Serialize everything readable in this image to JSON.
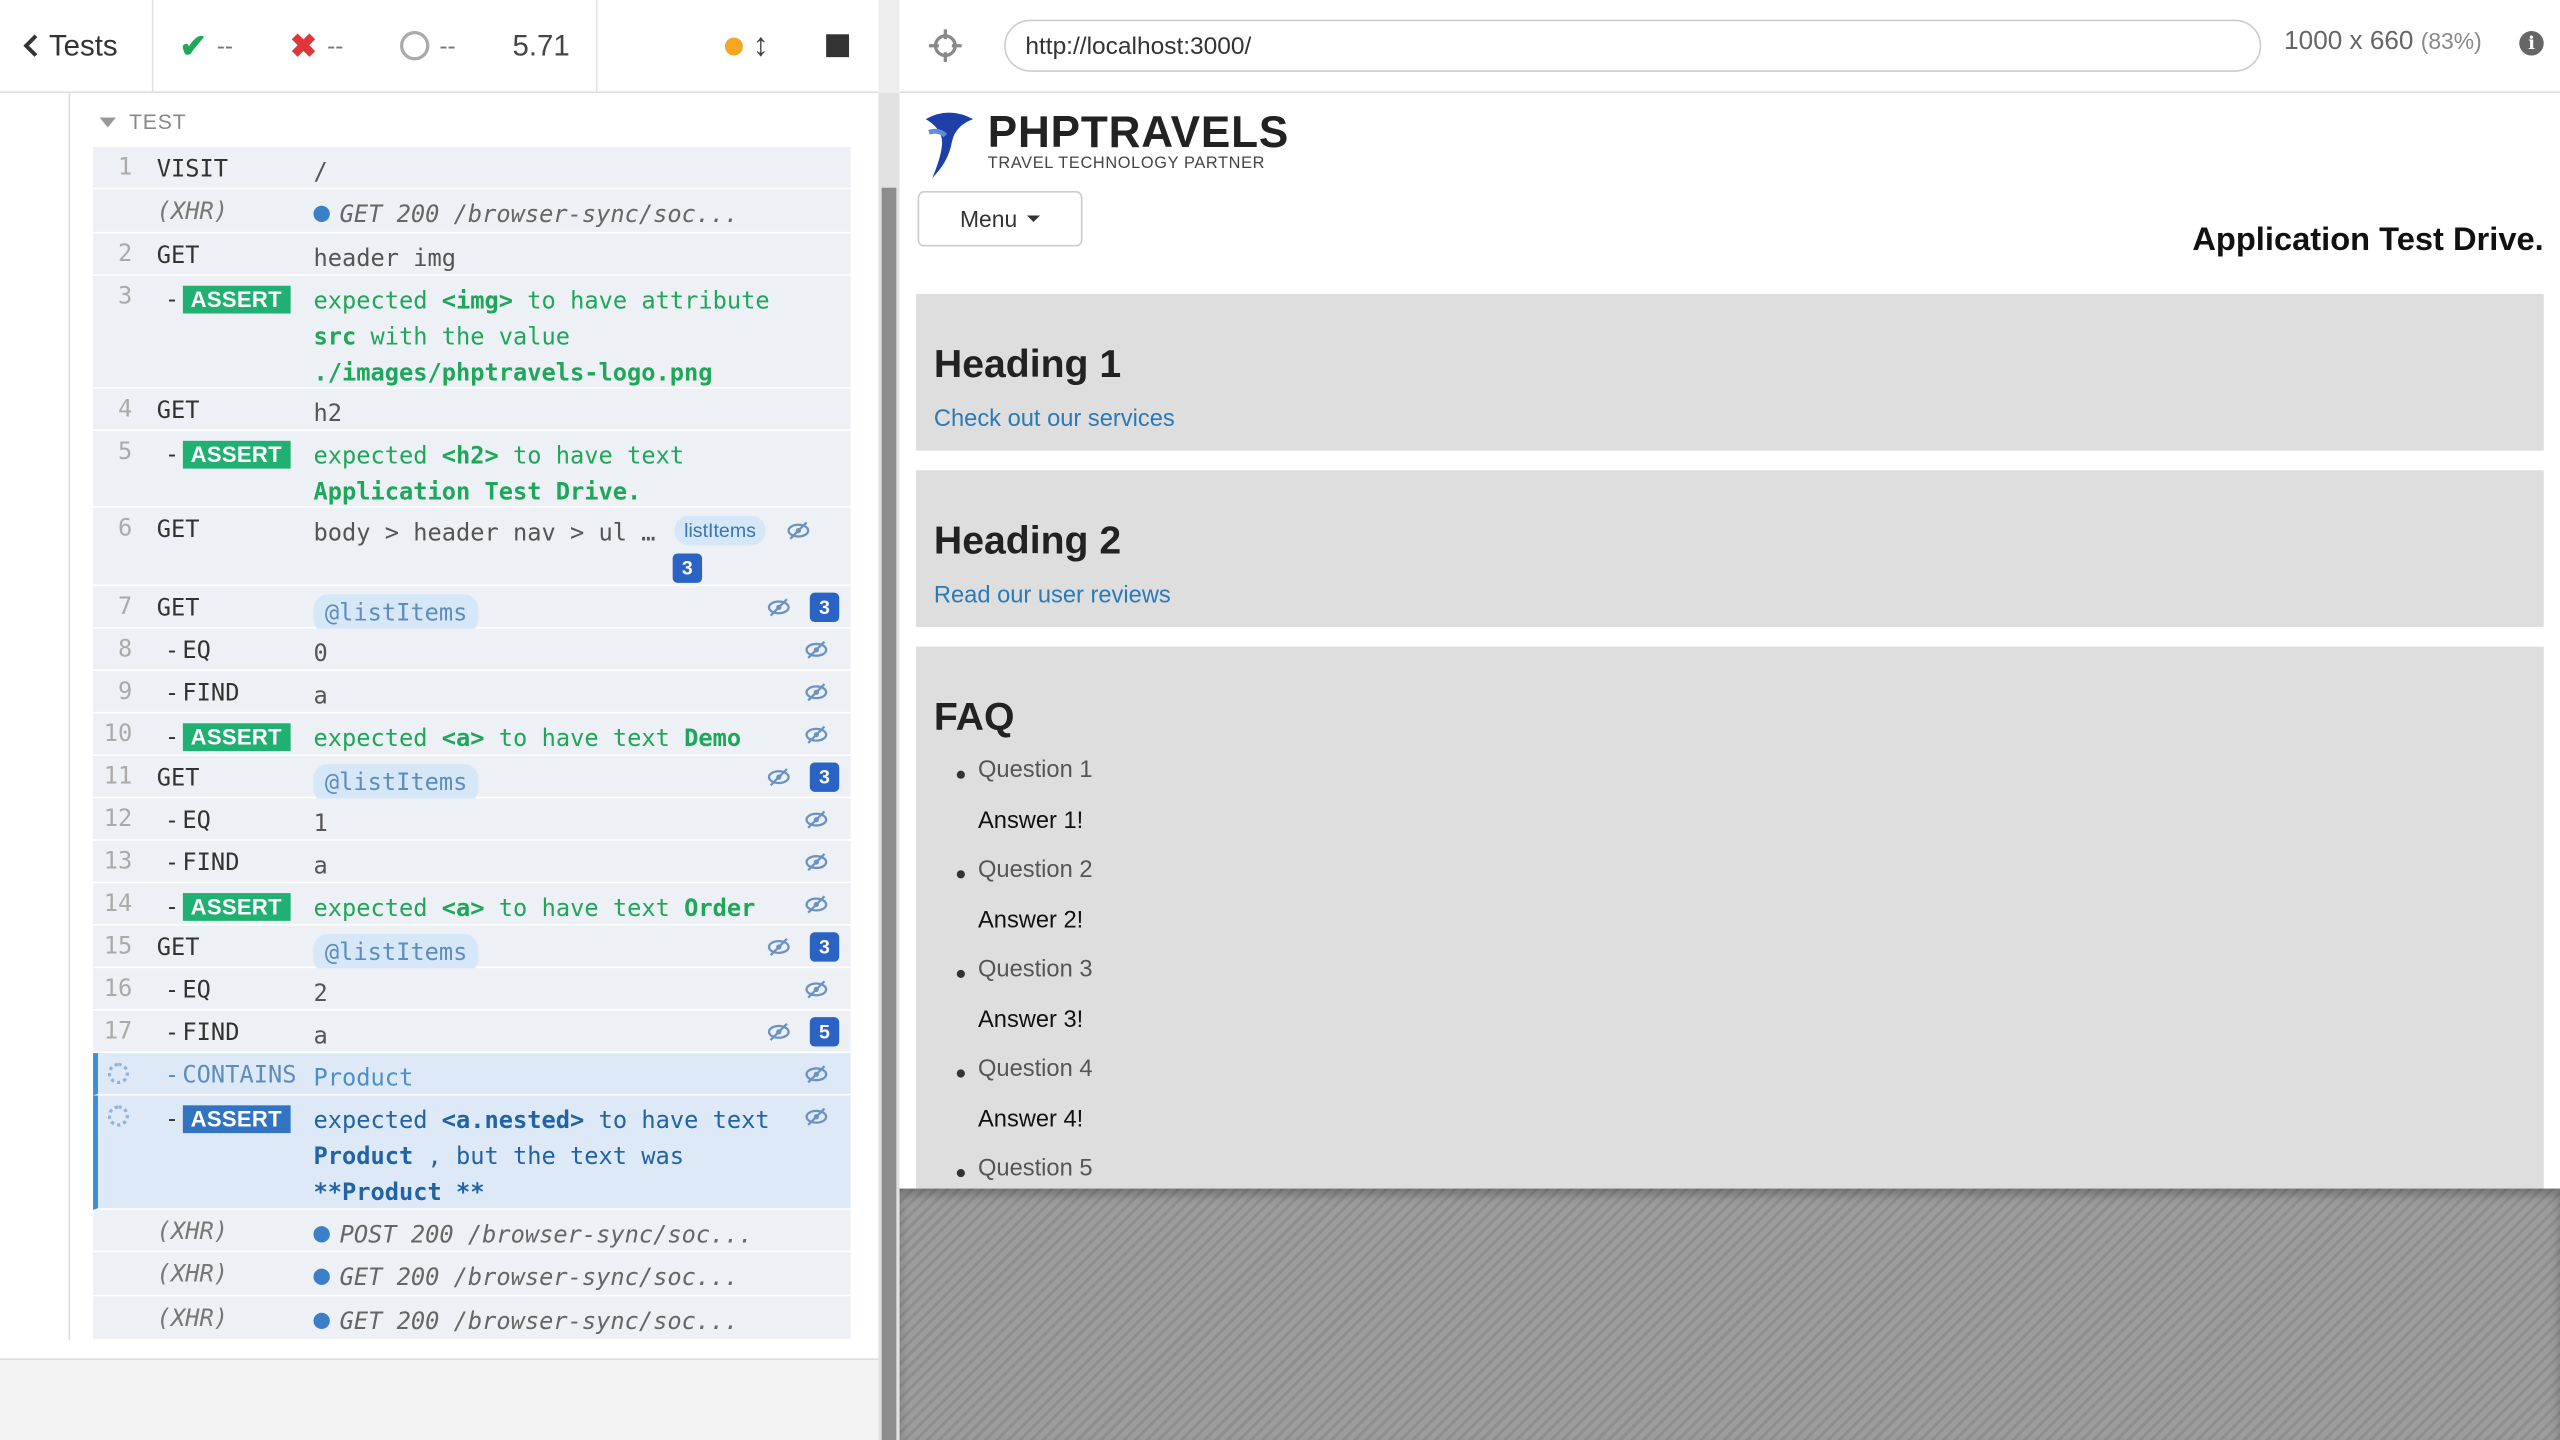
{
  "reporter": {
    "header": {
      "back_label": "Tests",
      "passed": "--",
      "failed": "--",
      "pending": "--",
      "duration": "5.71"
    },
    "test_title": "TEST",
    "commands": [
      {
        "num": "1",
        "name": "VISIT",
        "msg": "/"
      },
      {
        "num": "",
        "name": "(XHR)",
        "msg": "GET 200 /browser-sync/soc..."
      },
      {
        "num": "2",
        "name": "GET",
        "msg": "header img"
      },
      {
        "num": "3",
        "name": "ASSERT",
        "dash": "-",
        "msg_parts": [
          "expected ",
          "<img>",
          " to have attribute ",
          "src",
          " with the value ",
          "./images/phptravels-logo.png"
        ]
      },
      {
        "num": "4",
        "name": "GET",
        "msg": "h2"
      },
      {
        "num": "5",
        "name": "ASSERT",
        "dash": "-",
        "msg_parts": [
          "expected ",
          "<h2>",
          " to have text ",
          "Application Test Drive."
        ]
      },
      {
        "num": "6",
        "name": "GET",
        "msg": "body > header nav > ul …",
        "alias": "listItems",
        "count": "3"
      },
      {
        "num": "7",
        "name": "GET",
        "alias_msg": "@listItems",
        "count": "3"
      },
      {
        "num": "8",
        "name": "EQ",
        "dash": "-",
        "msg": "0"
      },
      {
        "num": "9",
        "name": "FIND",
        "dash": "-",
        "msg": "a"
      },
      {
        "num": "10",
        "name": "ASSERT",
        "dash": "-",
        "msg_parts": [
          "expected ",
          "<a>",
          " to have text ",
          "Demo"
        ]
      },
      {
        "num": "11",
        "name": "GET",
        "alias_msg": "@listItems",
        "count": "3"
      },
      {
        "num": "12",
        "name": "EQ",
        "dash": "-",
        "msg": "1"
      },
      {
        "num": "13",
        "name": "FIND",
        "dash": "-",
        "msg": "a"
      },
      {
        "num": "14",
        "name": "ASSERT",
        "dash": "-",
        "msg_parts": [
          "expected ",
          "<a>",
          " to have text ",
          "Order"
        ]
      },
      {
        "num": "15",
        "name": "GET",
        "alias_msg": "@listItems",
        "count": "3"
      },
      {
        "num": "16",
        "name": "EQ",
        "dash": "-",
        "msg": "2"
      },
      {
        "num": "17",
        "name": "FIND",
        "dash": "-",
        "msg": "a",
        "count": "5"
      },
      {
        "num": "",
        "name": "CONTAINS",
        "dash": "-",
        "msg": "Product"
      },
      {
        "num": "",
        "name": "ASSERT",
        "dash": "-",
        "msg_parts": [
          "expected ",
          "<a.nested>",
          " to have text ",
          "Product",
          " , but the text was ",
          "**Product **"
        ]
      },
      {
        "num": "",
        "name": "(XHR)",
        "msg": "POST 200 /browser-sync/soc..."
      },
      {
        "num": "",
        "name": "(XHR)",
        "msg": "GET 200 /browser-sync/soc..."
      },
      {
        "num": "",
        "name": "(XHR)",
        "msg": "GET 200 /browser-sync/soc..."
      }
    ]
  },
  "browser": {
    "url": "http://localhost:3000/",
    "viewport": "1000 x 660",
    "zoom": "(83%)",
    "info": "i"
  },
  "app": {
    "logo_word": "PHPTRAVELS",
    "logo_tag": "TRAVEL TECHNOLOGY PARTNER",
    "menu_label": "Menu",
    "tagline": "Application Test Drive.",
    "panel1": {
      "heading": "Heading 1",
      "link": "Check out our services"
    },
    "panel2": {
      "heading": "Heading 2",
      "link": "Read our user reviews"
    },
    "faq": {
      "heading": "FAQ",
      "items": [
        {
          "q": "Question 1",
          "a": "Answer 1!"
        },
        {
          "q": "Question 2",
          "a": "Answer 2!"
        },
        {
          "q": "Question 3",
          "a": "Answer 3!"
        },
        {
          "q": "Question 4",
          "a": "Answer 4!"
        },
        {
          "q": "Question 5",
          "a": ""
        }
      ]
    }
  },
  "colors": {
    "pass": "#1fa95a",
    "fail": "#e0363b",
    "running": "#f5a623",
    "assert_badge": "#1fb072",
    "pending_badge": "#3273c2",
    "link": "#2a7ab8"
  }
}
